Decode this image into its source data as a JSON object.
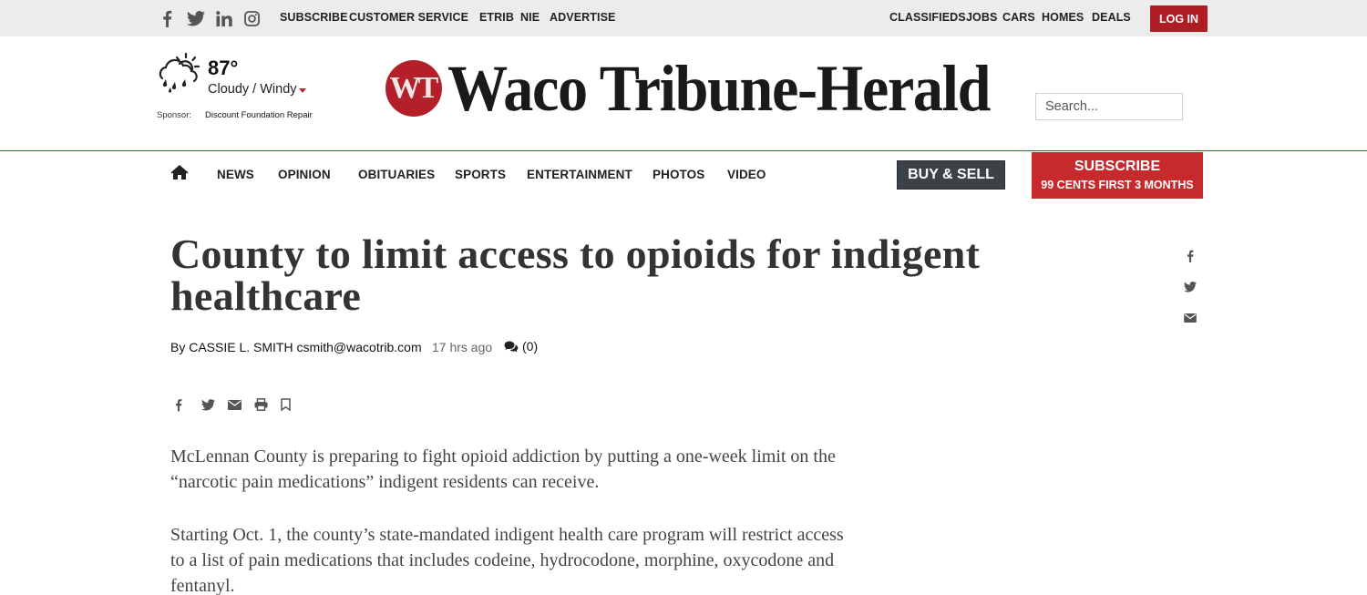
{
  "topbar": {
    "social_icons": [
      "facebook-icon",
      "twitter-icon",
      "linkedin-icon",
      "instagram-icon"
    ],
    "links_left": [
      "SUBSCRIBE",
      "CUSTOMER SERVICE",
      "ETRIB",
      "NIE",
      "ADVERTISE"
    ],
    "links_right": [
      "CLASSIFIEDS",
      "JOBS",
      "CARS",
      "HOMES",
      "DEALS"
    ],
    "login_label": "LOG IN"
  },
  "weather": {
    "icon": "cloudy-rain-icon",
    "temperature": "87°",
    "condition": "Cloudy / Windy",
    "sponsor_label": "Sponsor:",
    "sponsor_name": "Discount Foundation Repair"
  },
  "masthead": {
    "logo_initials": "WT",
    "logo_title": "Waco Tribune-Herald"
  },
  "search": {
    "placeholder": "Search..."
  },
  "nav": {
    "home_icon": "home-icon",
    "items": [
      "NEWS",
      "OPINION",
      "OBITUARIES",
      "SPORTS",
      "ENTERTAINMENT",
      "PHOTOS",
      "VIDEO"
    ],
    "buy_sell_label": "BUY & SELL",
    "subscribe_line1": "SUBSCRIBE",
    "subscribe_line2": "99 CENTS FIRST 3 MONTHS"
  },
  "article": {
    "headline": "County to limit access to opioids for indigent healthcare",
    "byline": "By CASSIE L. SMITH csmith@wacotrib.com",
    "time_ago": "17 hrs ago",
    "comment_count": "(0)",
    "share_icons": [
      "facebook-icon",
      "twitter-icon",
      "email-icon",
      "print-icon",
      "bookmark-icon"
    ],
    "side_share_icons": [
      "facebook-icon",
      "twitter-icon",
      "email-icon"
    ],
    "paragraphs": [
      "McLennan County is preparing to fight opioid addiction by putting a one-week limit on the “narcotic pain medications” indigent residents can receive.",
      "Starting Oct. 1, the county’s state-mandated indigent health care program will restrict access to a list of pain medications that includes codeine, hydrocodone, morphine, oxycodone and fentanyl."
    ]
  },
  "colors": {
    "brand_red": "#b3202a",
    "subscribe_red": "#c62a2c",
    "buy_sell_gray": "#3d4247",
    "topbar_bg": "#ececec"
  }
}
